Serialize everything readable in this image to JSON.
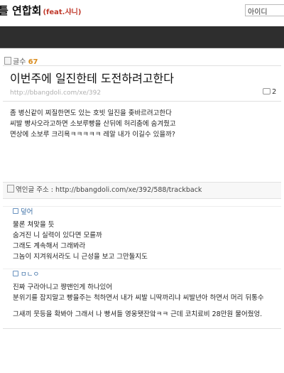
{
  "site": {
    "title": "틀 연합회",
    "subtitle": "(feat.샤니)",
    "login_placeholder": "아이디"
  },
  "post": {
    "count_label": "글수",
    "count_value": "67",
    "title": "이번주에 일진한테 도전하려고한다",
    "url": "http://bbangdoli.com/xe/392",
    "comment_count": "2",
    "body": [
      "좀 병신같이 찌질한면도 있는 호빗 일진을 좆바르려고한다",
      "씨발 빵사오라고하면 소보루빵을 산뒤에 허리춤에 숨겨줬고",
      "면상에 소보루 크리욕ㅋㅋㅋㅋㅋ 레알 내가 이길수 있을까?"
    ]
  },
  "trackback": {
    "label": "엮인글 주소 : http://bbangdoli.com/xe/392/588/trackback"
  },
  "comments": [
    {
      "author": "덮어",
      "lines": [
        "물론 쳐맞을 듯",
        "숨겨진 니 실력이 있다면 모를까",
        "그래도 계속해서 그래봐라",
        "그놈이 지겨워서라도 니 근성을 보고 그만둘지도"
      ]
    },
    {
      "author": "ㅁㄴㅇ",
      "lines": [
        "진짜 구라아니고 쨩맨인게 하나있어",
        "분위기를 잡지말고 빵을주는 척하면서 내가 씨발 니딱까리냐 씨발년아 하면서 머리 뒤통수",
        "",
        "그새끼 뭇등을 확봐아 그래서 나 빵셔들 영웅됏잔앜ㅋㅋ 근데 코치료비 28만원 물어줬엉."
      ]
    }
  ]
}
